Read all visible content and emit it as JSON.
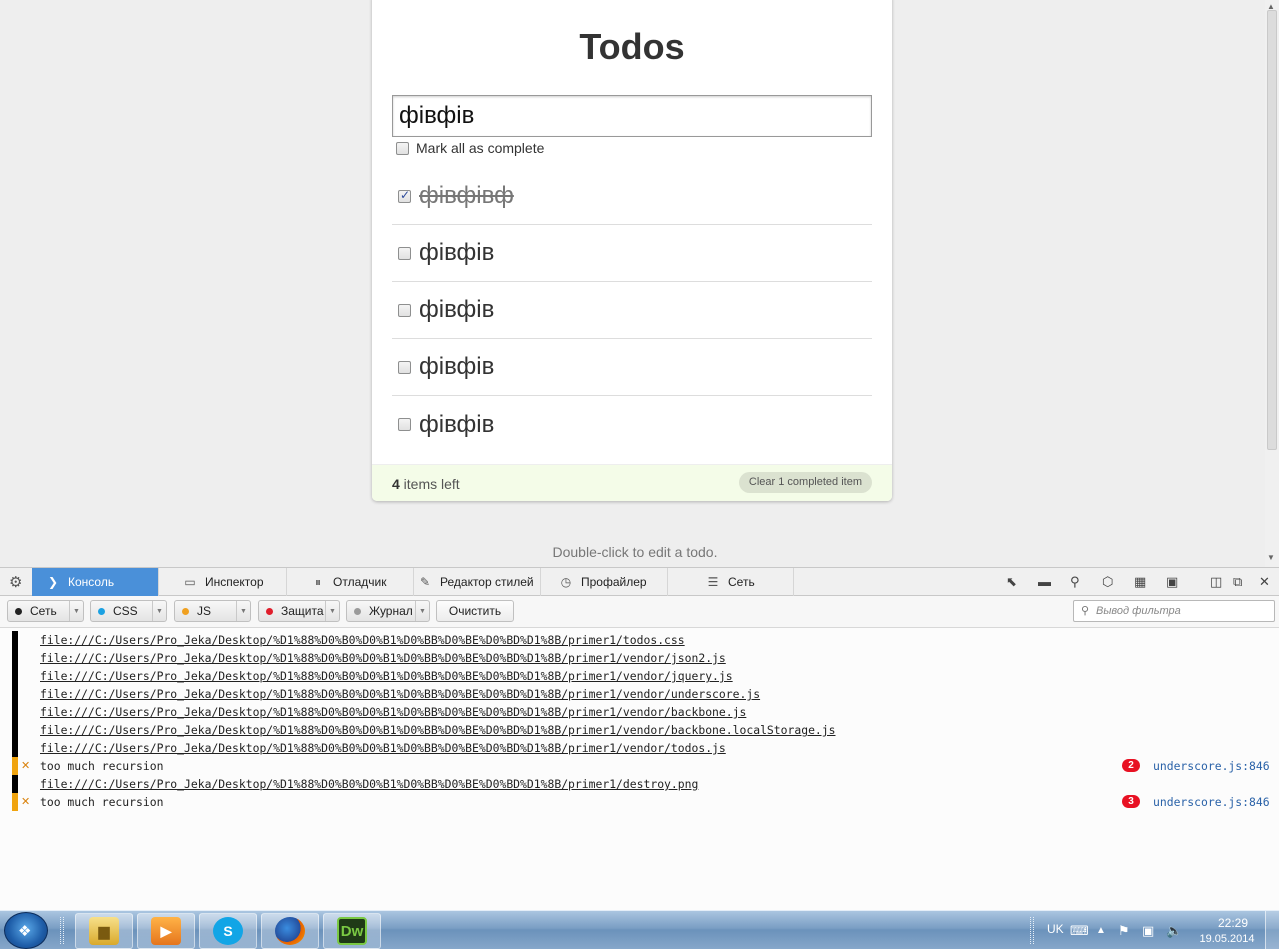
{
  "todoapp": {
    "title": "Todos",
    "new_todo_value": "фівфів",
    "toggle_all_label": "Mark all as complete",
    "items": [
      {
        "text": "фівфівф",
        "done": true
      },
      {
        "text": "фівфів",
        "done": false
      },
      {
        "text": "фівфів",
        "done": false
      },
      {
        "text": "фівфів",
        "done": false
      },
      {
        "text": "фівфів",
        "done": false
      }
    ],
    "footer": {
      "count": "4",
      "count_suffix": " items left",
      "clear_label": "Clear 1 completed item"
    },
    "instructions": "Double-click to edit a todo."
  },
  "devtools": {
    "tabs": [
      {
        "label": "Консоль",
        "icon": "console-icon",
        "active": true
      },
      {
        "label": "Инспектор",
        "icon": "inspector-icon",
        "active": false
      },
      {
        "label": "Отладчик",
        "icon": "debugger-icon",
        "active": false
      },
      {
        "label": "Редактор стилей",
        "icon": "style-editor-icon",
        "active": false
      },
      {
        "label": "Профайлер",
        "icon": "profiler-icon",
        "active": false
      },
      {
        "label": "Сеть",
        "icon": "network-icon",
        "active": false
      }
    ],
    "filters": [
      {
        "label": "Сеть",
        "color": "#222222"
      },
      {
        "label": "CSS",
        "color": "#1ba1e2"
      },
      {
        "label": "JS",
        "color": "#f0a020"
      },
      {
        "label": "Защита",
        "color": "#e01d2b"
      },
      {
        "label": "Журнал",
        "color": "#9a9a9a"
      }
    ],
    "clear_label": "Очистить",
    "filter_placeholder": "Вывод фильтра",
    "log": [
      {
        "kind": "net",
        "text": "file:///C:/Users/Pro_Jeka/Desktop/%D1%88%D0%B0%D0%B1%D0%BB%D0%BE%D0%BD%D1%8B/primer1/todos.css"
      },
      {
        "kind": "net",
        "text": "file:///C:/Users/Pro_Jeka/Desktop/%D1%88%D0%B0%D0%B1%D0%BB%D0%BE%D0%BD%D1%8B/primer1/vendor/json2.js"
      },
      {
        "kind": "net",
        "text": "file:///C:/Users/Pro_Jeka/Desktop/%D1%88%D0%B0%D0%B1%D0%BB%D0%BE%D0%BD%D1%8B/primer1/vendor/jquery.js"
      },
      {
        "kind": "net",
        "text": "file:///C:/Users/Pro_Jeka/Desktop/%D1%88%D0%B0%D0%B1%D0%BB%D0%BE%D0%BD%D1%8B/primer1/vendor/underscore.js"
      },
      {
        "kind": "net",
        "text": "file:///C:/Users/Pro_Jeka/Desktop/%D1%88%D0%B0%D0%B1%D0%BB%D0%BE%D0%BD%D1%8B/primer1/vendor/backbone.js"
      },
      {
        "kind": "net",
        "text": "file:///C:/Users/Pro_Jeka/Desktop/%D1%88%D0%B0%D0%B1%D0%BB%D0%BE%D0%BD%D1%8B/primer1/vendor/backbone.localStorage.js"
      },
      {
        "kind": "net",
        "text": "file:///C:/Users/Pro_Jeka/Desktop/%D1%88%D0%B0%D0%B1%D0%BB%D0%BE%D0%BD%D1%8B/primer1/vendor/todos.js"
      },
      {
        "kind": "err",
        "text": "too much recursion",
        "count": "2",
        "location": "underscore.js:846"
      },
      {
        "kind": "net",
        "text": "file:///C:/Users/Pro_Jeka/Desktop/%D1%88%D0%B0%D0%B1%D0%BB%D0%BE%D0%BD%D1%8B/primer1/destroy.png"
      },
      {
        "kind": "err",
        "text": "too much recursion",
        "count": "3",
        "location": "underscore.js:846"
      }
    ]
  },
  "taskbar": {
    "apps": [
      {
        "name": "explorer",
        "icon": "folder-icon"
      },
      {
        "name": "media-player",
        "icon": "media-player-icon"
      },
      {
        "name": "skype",
        "icon": "skype-icon"
      },
      {
        "name": "firefox",
        "icon": "firefox-icon"
      },
      {
        "name": "dreamweaver",
        "icon": "dreamweaver-icon",
        "label": "Dw"
      }
    ],
    "language": "UK",
    "time": "22:29",
    "date": "19.05.2014"
  }
}
